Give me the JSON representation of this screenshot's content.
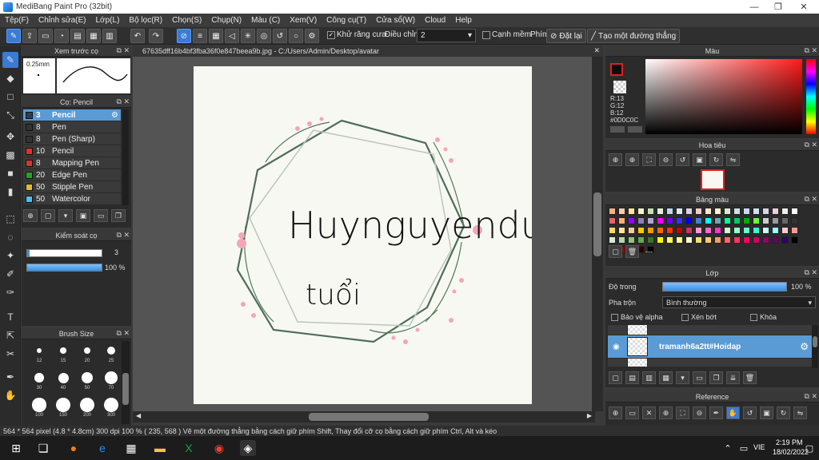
{
  "window": {
    "title": "MediBang Paint Pro (32bit)"
  },
  "menu": [
    "Tệp(F)",
    "Chỉnh sửa(E)",
    "Lớp(L)",
    "Bộ lọc(R)",
    "Chọn(S)",
    "Chụp(N)",
    "Màu (C)",
    "Xem(V)",
    "Công cụ(T)",
    "Cửa sổ(W)",
    "Cloud",
    "Help"
  ],
  "toolbar": {
    "antialias_label": "Khử răng cưa",
    "antialias_checked": true,
    "adjust_label": "Điều chỉnh",
    "adjust_value": "2",
    "smooth_label": "Cạnh mềm",
    "key_label": "Phím",
    "reset_label": "Đặt lại",
    "straight_label": "Tạo một đường thẳng"
  },
  "preview_panel": {
    "title": "Xem trước cọ",
    "size": "0.25mm"
  },
  "brush_panel": {
    "title": "Cọ: Pencil",
    "items": [
      {
        "size": "3",
        "name": "Pencil",
        "color": "#2a3f55",
        "selected": true
      },
      {
        "size": "8",
        "name": "Pen",
        "color": "#333333"
      },
      {
        "size": "8",
        "name": "Pen (Sharp)",
        "color": "#333333"
      },
      {
        "size": "10",
        "name": "Pencil",
        "color": "#e03030"
      },
      {
        "size": "8",
        "name": "Mapping Pen",
        "color": "#e03030"
      },
      {
        "size": "20",
        "name": "Edge Pen",
        "color": "#2aa02a"
      },
      {
        "size": "50",
        "name": "Stipple Pen",
        "color": "#e0c020"
      },
      {
        "size": "50",
        "name": "Watercolor",
        "color": "#50c0e8"
      }
    ]
  },
  "control_panel": {
    "title": "Kiểm soát cọ",
    "size_value": "3",
    "opacity_value": "100 %",
    "opacity_fill": 1.0
  },
  "brushsize_panel": {
    "title": "Brush Size",
    "sizes": [
      "12",
      "15",
      "20",
      "25",
      "30",
      "40",
      "50",
      "70",
      "100",
      "150",
      "200",
      "300"
    ]
  },
  "canvas": {
    "tab_title": "67635dff16b4bf3fba36f0e847beea9b.jpg - C:/Users/Admin/Desktop/avatar",
    "text_line1": "Huynguyenduc",
    "text_line2": "tuổi"
  },
  "color_panel": {
    "title": "Màu",
    "r": "R:13",
    "g": "G:12",
    "b": "B:12",
    "hex": "#0D0C0C",
    "current": "#0d0c0c"
  },
  "navigator": {
    "title": "Hoa tiêu"
  },
  "palette": {
    "title": "Bảng màu",
    "extra": "---"
  },
  "layers": {
    "title": "Lớp",
    "opacity_label": "Độ trong",
    "opacity_value": "100 %",
    "opacity_fill": 1.0,
    "blend_label": "Pha trộn",
    "blend_value": "Bình thường",
    "alpha_label": "Bảo vệ alpha",
    "clip_label": "Xén bớt",
    "lock_label": "Khóa",
    "selected_layer": "tramanh6a2tt#Hoidap"
  },
  "reference": {
    "title": "Reference"
  },
  "status": {
    "dims": "564 * 564 pixel",
    "physical": "(4.8 * 4.8cm)",
    "dpi": "300 dpi",
    "zoom": "100 %",
    "coords": "( 235, 568 )",
    "hint": "Vẽ một đường thẳng bằng cách giữ phím Shift, Thay đổi cỡ cọ bằng cách giữ phím Ctrl, Alt và kéo"
  },
  "taskbar": {
    "lang": "VIE",
    "time": "2:19 PM",
    "date": "18/02/2022"
  }
}
